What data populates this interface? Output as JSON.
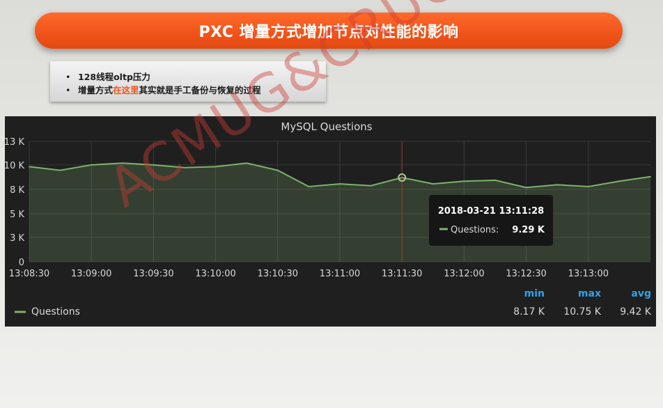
{
  "slide": {
    "title": "PXC 增量方式增加节点对性能的影响",
    "bullets": [
      {
        "bullet": "•",
        "text": "128线程oltp压力"
      },
      {
        "bullet": "•",
        "pre": "增量方式",
        "highlight": "在这里",
        "post": "其实就是手工备份与恢复的过程"
      }
    ],
    "watermark": "ACMUG&CRUG 2018"
  },
  "chart_data": {
    "type": "line",
    "title": "MySQL Questions",
    "x": [
      "13:08:30",
      "13:08:45",
      "13:09:00",
      "13:09:15",
      "13:09:30",
      "13:09:45",
      "13:10:00",
      "13:10:15",
      "13:10:30",
      "13:10:45",
      "13:11:00",
      "13:11:15",
      "13:11:30",
      "13:11:45",
      "13:12:00",
      "13:12:15",
      "13:12:30",
      "13:12:45",
      "13:13:00",
      "13:13:15",
      "13:13:30"
    ],
    "series": [
      {
        "name": "Questions",
        "color": "#7eb26d",
        "values": [
          10.5,
          10.1,
          10.7,
          10.9,
          10.7,
          10.4,
          10.5,
          10.9,
          10.1,
          8.3,
          8.6,
          8.4,
          9.3,
          8.6,
          8.9,
          9.0,
          8.2,
          8.5,
          8.3,
          8.9,
          9.4
        ]
      }
    ],
    "xticks": [
      "13:08:30",
      "13:09:00",
      "13:09:30",
      "13:10:00",
      "13:10:30",
      "13:11:00",
      "13:11:30",
      "13:12:00",
      "13:12:30",
      "13:13:00"
    ],
    "yticks": [
      0,
      2.7,
      5.3,
      8,
      10.7,
      13.3
    ],
    "ytick_labels": [
      "0",
      "3 K",
      "5 K",
      "8 K",
      "10 K",
      "13 K"
    ],
    "ylim": [
      0,
      13.3
    ],
    "grid": true,
    "legend": {
      "position": "bottom-left",
      "entries": [
        "Questions"
      ]
    },
    "legend_stats": {
      "headers": [
        "min",
        "max",
        "avg"
      ],
      "values": [
        "8.17 K",
        "10.75 K",
        "9.42 K"
      ]
    },
    "tooltip": {
      "time": "2018-03-21 13:11:28",
      "label": "Questions:",
      "value": "9.29 K",
      "index": 12
    },
    "colors": {
      "line": "#7eb26d",
      "panel_bg": "#1f1f20",
      "grid": "#3a3a3a",
      "cursor": "#9a3a2a",
      "stat_header": "#33a2e5"
    }
  }
}
